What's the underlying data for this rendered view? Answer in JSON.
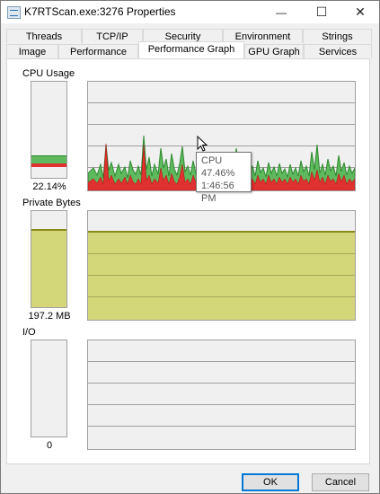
{
  "window": {
    "title": "K7RTScan.exe:3276 Properties",
    "minimize": "—",
    "maximize": "☐",
    "close": "✕"
  },
  "tabs": {
    "row1": [
      "Threads",
      "TCP/IP",
      "Security",
      "Environment",
      "Strings"
    ],
    "row2": [
      "Image",
      "Performance",
      "Performance Graph",
      "GPU Graph",
      "Services"
    ],
    "active": "Performance Graph"
  },
  "sections": {
    "cpu": {
      "label": "CPU Usage",
      "value": "22.14%",
      "level": 0.22
    },
    "private": {
      "label": "Private Bytes",
      "value": "197.2 MB",
      "level": 0.79
    },
    "io": {
      "label": "I/O",
      "value": "0",
      "level": 0
    }
  },
  "tooltip": {
    "title": "CPU",
    "value": "47.46%",
    "time": "1:46:56 PM"
  },
  "buttons": {
    "ok": "OK",
    "cancel": "Cancel"
  },
  "colors": {
    "cpu_total": "#5fb95f",
    "cpu_kernel": "#e03030",
    "private_fill": "#d4d67a",
    "private_line": "#8a8a1a"
  }
}
